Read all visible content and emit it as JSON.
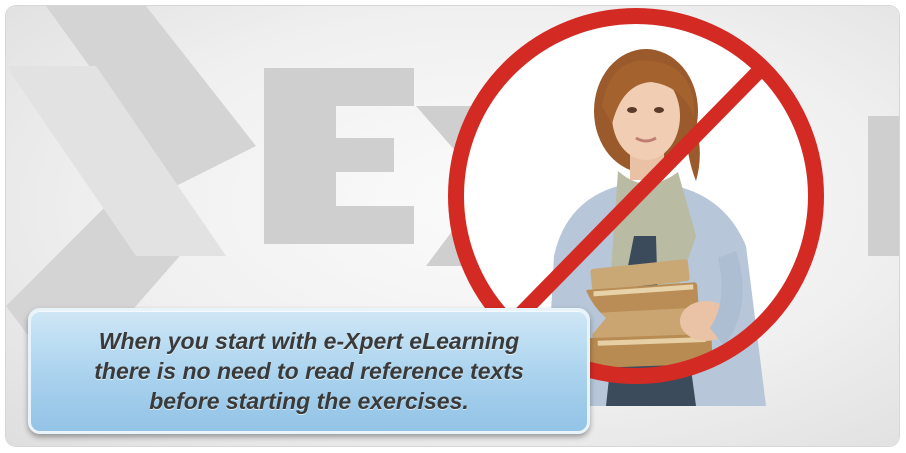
{
  "caption": {
    "lines": [
      "When you start with e-Xpert eLearning",
      "there is no need to read reference texts",
      "before starting the exercises."
    ]
  },
  "background": {
    "logo_mark": "X",
    "logo_word": "Ex",
    "logo_trail": "r"
  },
  "colors": {
    "prohibition_red": "#d42a24",
    "caption_blue": "#a9d2ee",
    "watermark_gray": "#cfcfcf"
  },
  "icons": {
    "prohibition": "no-sign-icon"
  }
}
